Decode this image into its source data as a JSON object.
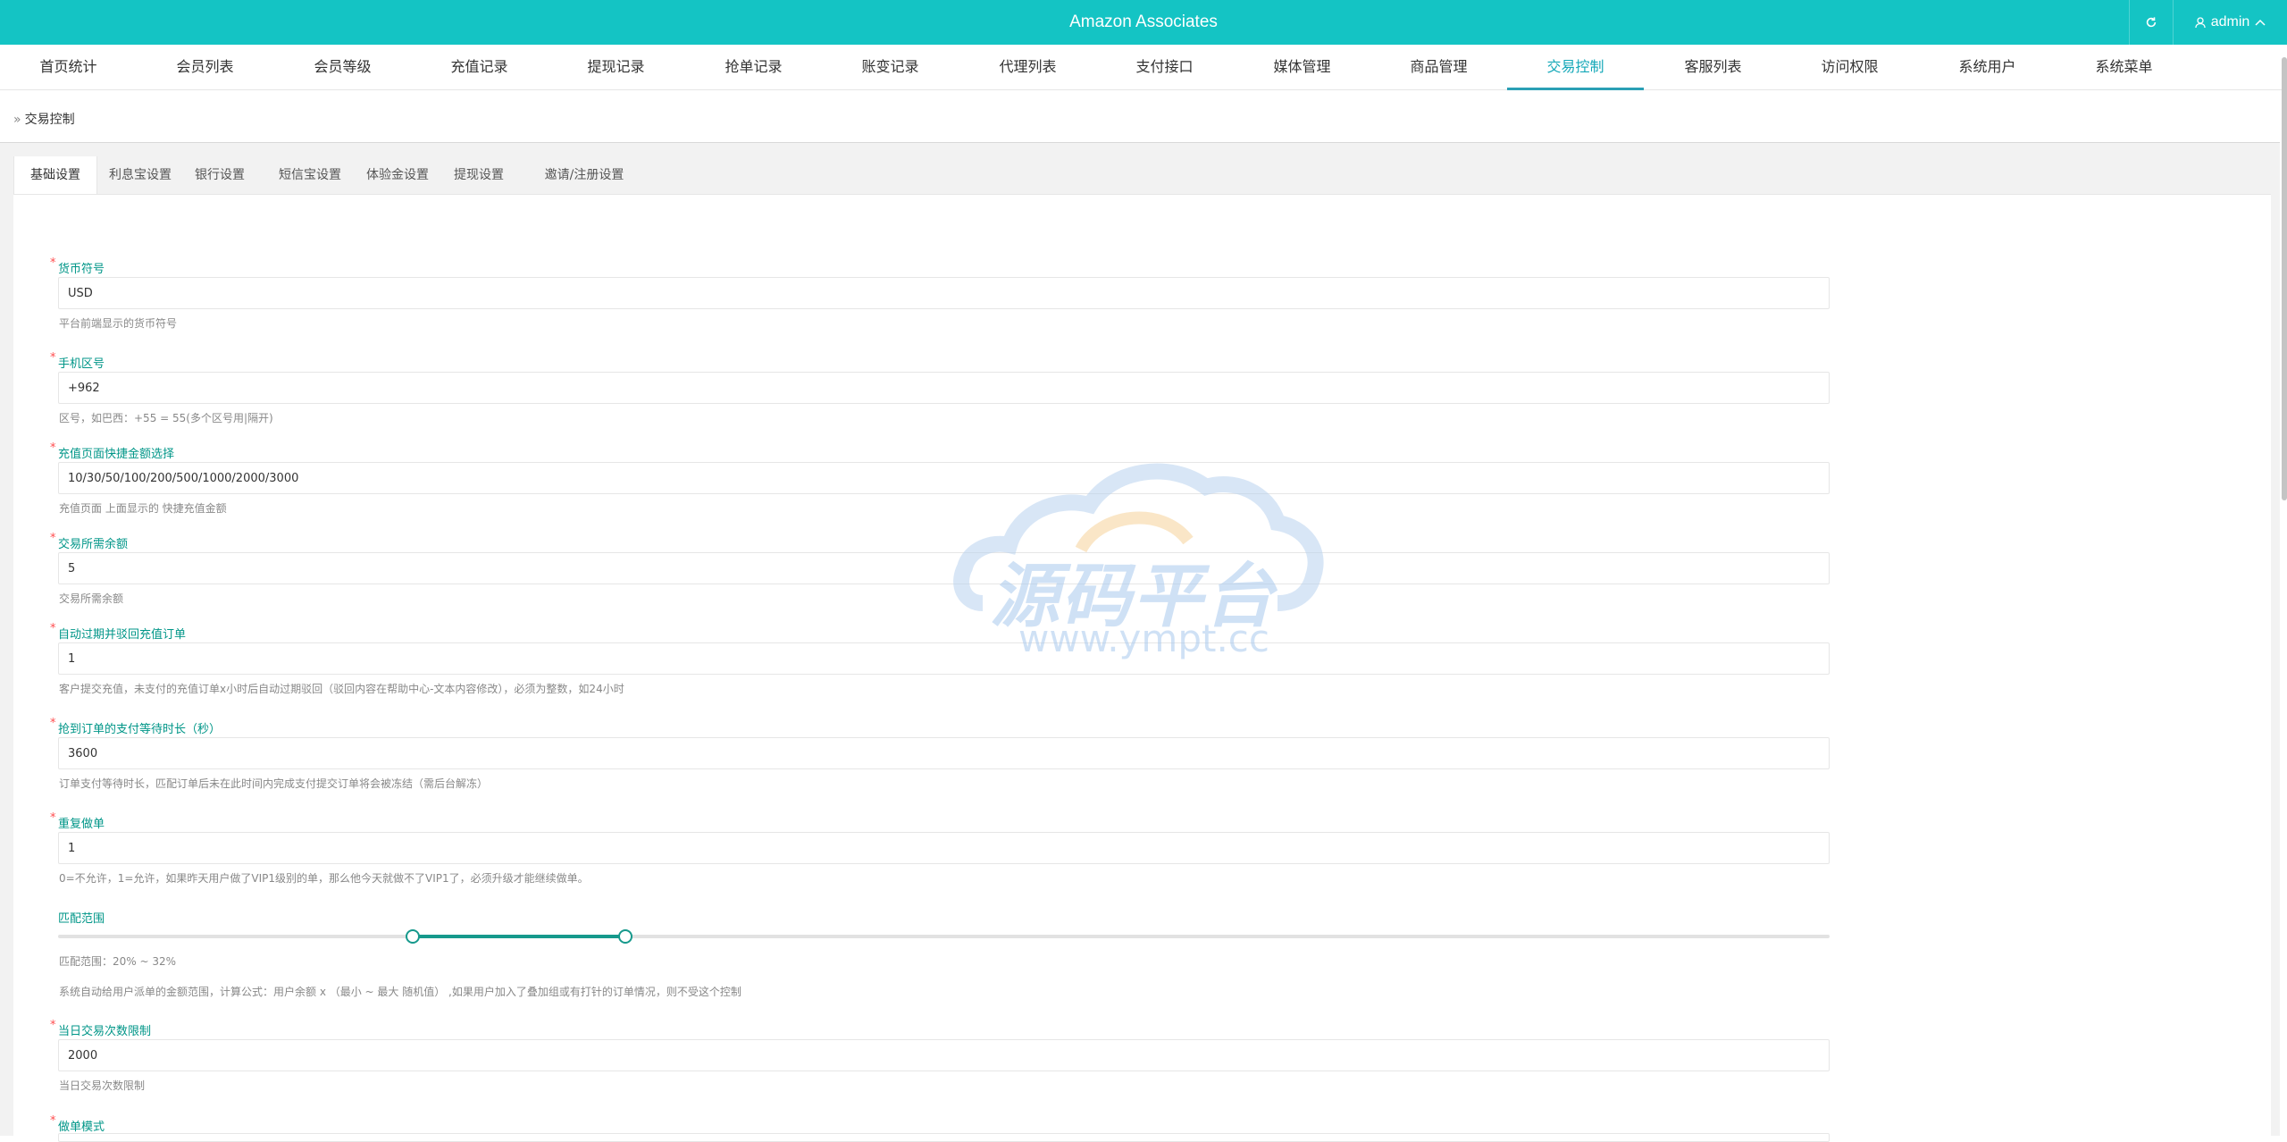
{
  "header": {
    "title": "Amazon Associates",
    "user": "admin"
  },
  "nav": [
    {
      "label": "首页统计"
    },
    {
      "label": "会员列表"
    },
    {
      "label": "会员等级"
    },
    {
      "label": "充值记录"
    },
    {
      "label": "提现记录"
    },
    {
      "label": "抢单记录"
    },
    {
      "label": "账变记录"
    },
    {
      "label": "代理列表"
    },
    {
      "label": "支付接口"
    },
    {
      "label": "媒体管理"
    },
    {
      "label": "商品管理"
    },
    {
      "label": "交易控制"
    },
    {
      "label": "客服列表"
    },
    {
      "label": "访问权限"
    },
    {
      "label": "系统用户"
    },
    {
      "label": "系统菜单"
    }
  ],
  "nav_active": "交易控制",
  "breadcrumb": "交易控制",
  "tabs": [
    {
      "label": "基础设置"
    },
    {
      "label": "利息宝设置"
    },
    {
      "label": "银行设置"
    },
    {
      "label": "短信宝设置"
    },
    {
      "label": "体验金设置"
    },
    {
      "label": "提现设置"
    },
    {
      "label": "邀请/注册设置"
    }
  ],
  "tab_active": "基础设置",
  "form": {
    "currency": {
      "label": "货币符号",
      "value": "USD",
      "hint": "平台前端显示的货币符号"
    },
    "phone_code": {
      "label": "手机区号",
      "value": "+962",
      "hint": "区号，如巴西：+55 = 55(多个区号用|隔开)"
    },
    "quick_amounts": {
      "label": "充值页面快捷金额选择",
      "value": "10/30/50/100/200/500/1000/2000/3000",
      "hint": "充值页面 上面显示的 快捷充值金额"
    },
    "min_balance": {
      "label": "交易所需余额",
      "value": "5",
      "hint": "交易所需余额"
    },
    "auto_expire": {
      "label": "自动过期并驳回充值订单",
      "value": "1",
      "hint": "客户提交充值，未支付的充值订单x小时后自动过期驳回（驳回内容在帮助中心-文本内容修改），必须为整数，如24小时"
    },
    "pay_wait": {
      "label": "抢到订单的支付等待时长（秒）",
      "value": "3600",
      "hint": "订单支付等待时长，匹配订单后未在此时间内完成支付提交订单将会被冻结（需后台解冻）"
    },
    "repeat_order": {
      "label": "重复做单",
      "value": "1",
      "hint": "0=不允许，1=允许，如果昨天用户做了VIP1级别的单，那么他今天就做不了VIP1了，必须升级才能继续做单。"
    },
    "match_range": {
      "label": "匹配范围",
      "min": 20,
      "max": 32,
      "range_text": "匹配范围：20% ~ 32%",
      "hint": "系统自动给用户派单的金额范围，计算公式：用户余额 x （最小 ~ 最大 随机值） ,如果用户加入了叠加组或有打针的订单情况，则不受这个控制"
    },
    "daily_limit": {
      "label": "当日交易次数限制",
      "value": "2000",
      "hint": "当日交易次数限制"
    },
    "order_mode": {
      "label": "做单模式"
    }
  },
  "watermark": {
    "title": "源码平台",
    "url": "www.ympt.cc"
  },
  "colors": {
    "primary": "#14c4c4",
    "accent": "#009688",
    "slider": "#16998c"
  }
}
